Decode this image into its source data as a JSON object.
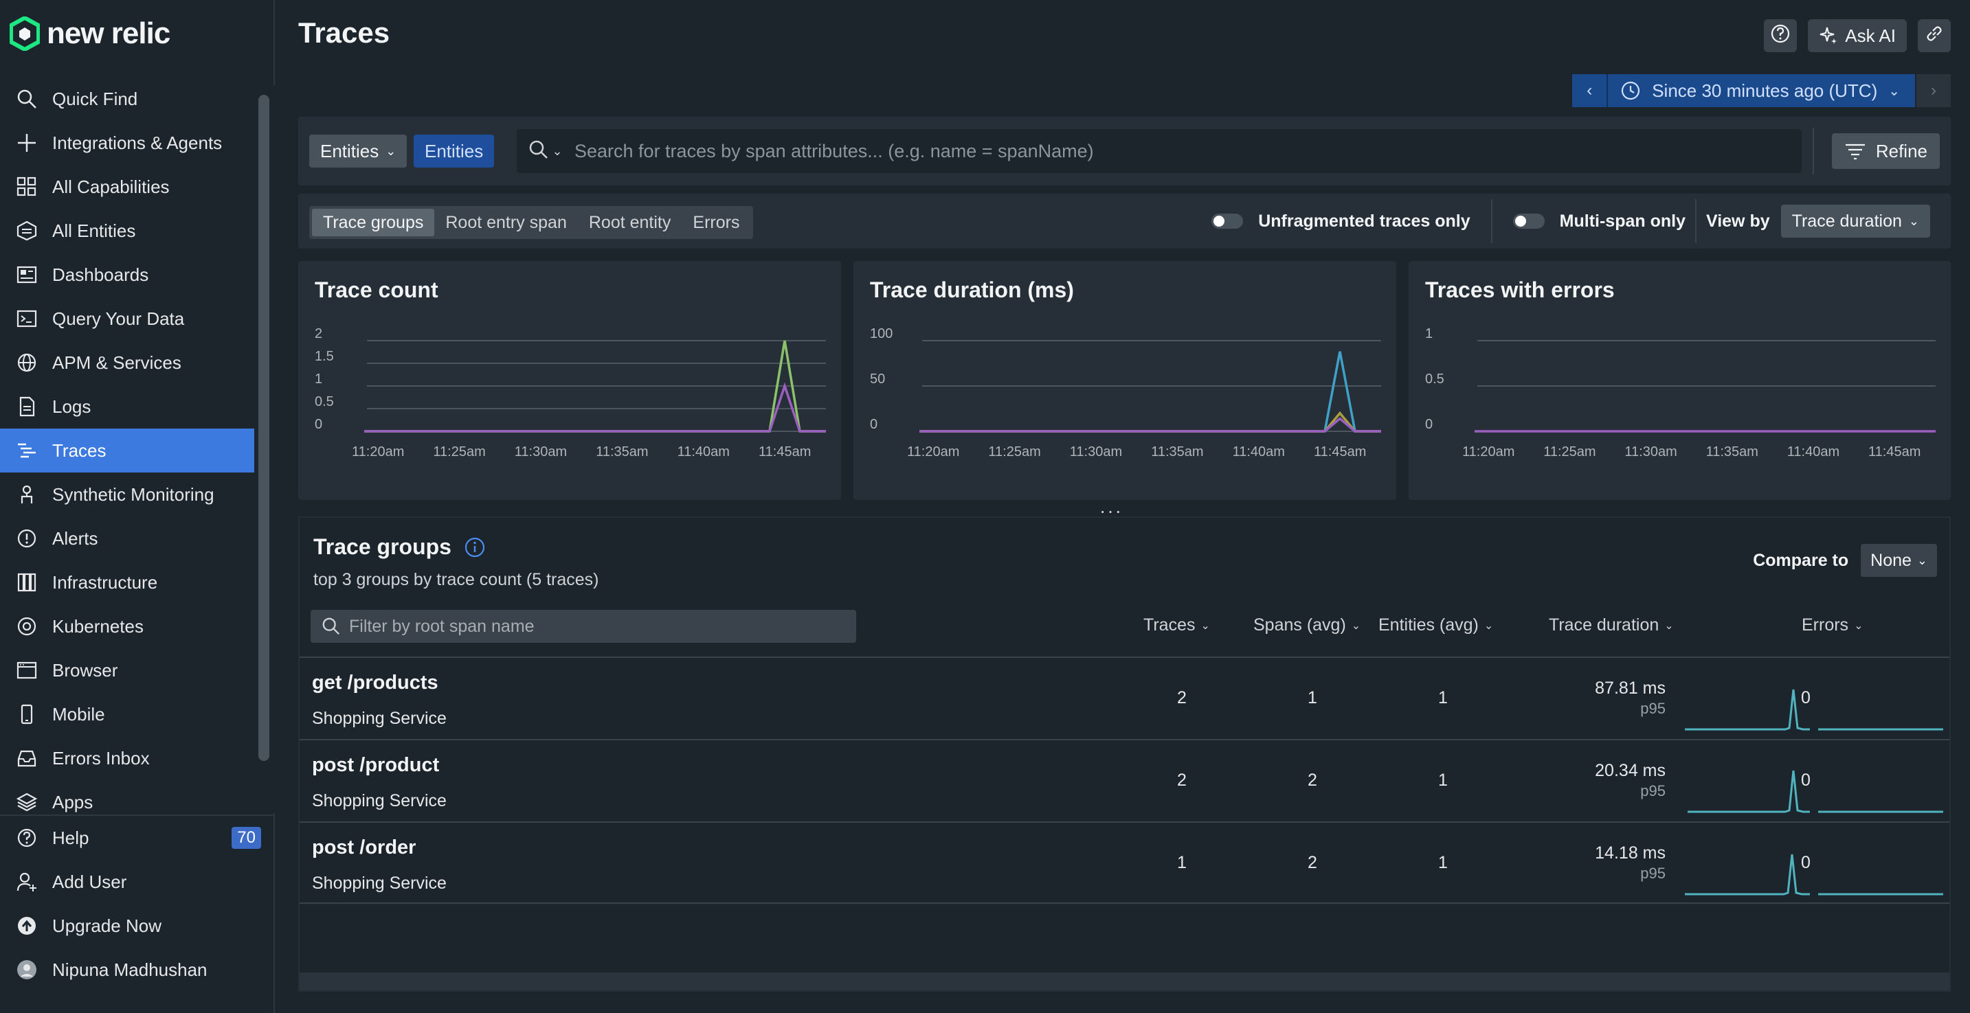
{
  "app": {
    "logo_text": "new relic"
  },
  "sidebar": {
    "items": [
      {
        "label": "Quick Find",
        "icon": "search-icon"
      },
      {
        "label": "Integrations & Agents",
        "icon": "plus-icon"
      },
      {
        "label": "All Capabilities",
        "icon": "grid-icon"
      },
      {
        "label": "All Entities",
        "icon": "entities-icon"
      },
      {
        "label": "Dashboards",
        "icon": "dashboard-icon"
      },
      {
        "label": "Query Your Data",
        "icon": "terminal-icon"
      },
      {
        "label": "APM & Services",
        "icon": "globe-icon"
      },
      {
        "label": "Logs",
        "icon": "document-icon"
      },
      {
        "label": "Traces",
        "icon": "traces-icon",
        "active": true
      },
      {
        "label": "Synthetic Monitoring",
        "icon": "robot-icon"
      },
      {
        "label": "Alerts",
        "icon": "alert-icon"
      },
      {
        "label": "Infrastructure",
        "icon": "columns-icon"
      },
      {
        "label": "Kubernetes",
        "icon": "kubernetes-icon"
      },
      {
        "label": "Browser",
        "icon": "browser-icon"
      },
      {
        "label": "Mobile",
        "icon": "mobile-icon"
      },
      {
        "label": "Errors Inbox",
        "icon": "inbox-icon"
      },
      {
        "label": "Apps",
        "icon": "layers-icon"
      }
    ],
    "bottom": [
      {
        "label": "Help",
        "icon": "help-icon",
        "badge": "70"
      },
      {
        "label": "Add User",
        "icon": "add-user-icon"
      },
      {
        "label": "Upgrade Now",
        "icon": "upgrade-icon"
      },
      {
        "label": "Nipuna Madhushan",
        "icon": "avatar"
      }
    ]
  },
  "header": {
    "title": "Traces",
    "ask_ai": "Ask AI",
    "time_range": "Since 30 minutes ago (UTC)"
  },
  "filter_bar": {
    "entities_dropdown": "Entities",
    "entities_pill": "Entities",
    "search_placeholder": "Search for traces by span attributes... (e.g. name = spanName)",
    "refine": "Refine"
  },
  "tabs": [
    "Trace groups",
    "Root entry span",
    "Root entity",
    "Errors"
  ],
  "toggles": {
    "unfragmented": "Unfragmented traces only",
    "multispan": "Multi-span only",
    "view_by_label": "View by",
    "view_by_value": "Trace duration"
  },
  "chart_data": [
    {
      "type": "line",
      "title": "Trace count",
      "x": [
        "11:20am",
        "11:25am",
        "11:30am",
        "11:35am",
        "11:40am",
        "11:45am"
      ],
      "y_ticks": [
        "2",
        "1.5",
        "1",
        "0.5",
        "0"
      ],
      "ylim": [
        0,
        2
      ],
      "series": [
        {
          "color": "#8dc26a",
          "peak": 2
        },
        {
          "color": "#9b5fc0",
          "peak": 1
        }
      ]
    },
    {
      "type": "line",
      "title": "Trace duration (ms)",
      "x": [
        "11:20am",
        "11:25am",
        "11:30am",
        "11:35am",
        "11:40am",
        "11:45am"
      ],
      "y_ticks": [
        "100",
        "50",
        "0"
      ],
      "ylim": [
        0,
        100
      ],
      "series": [
        {
          "color": "#3fa0c8",
          "peak": 88
        },
        {
          "color": "#a8a040",
          "peak": 20
        },
        {
          "color": "#9b5fc0",
          "peak": 14
        }
      ]
    },
    {
      "type": "line",
      "title": "Traces with errors",
      "x": [
        "11:20am",
        "11:25am",
        "11:30am",
        "11:35am",
        "11:40am",
        "11:45am"
      ],
      "y_ticks": [
        "1",
        "0.5",
        "0"
      ],
      "ylim": [
        0,
        1
      ],
      "series": [
        {
          "color": "#9b5fc0",
          "peak": 0
        }
      ]
    }
  ],
  "trace_groups": {
    "title": "Trace groups",
    "subtitle": "top 3 groups by trace count (5 traces)",
    "compare_label": "Compare to",
    "compare_value": "None",
    "filter_placeholder": "Filter by root span name",
    "columns": [
      "Traces",
      "Spans (avg)",
      "Entities (avg)",
      "Trace duration",
      "Errors"
    ],
    "rows": [
      {
        "name": "get /products",
        "service": "Shopping Service",
        "traces": "2",
        "spans": "1",
        "entities": "1",
        "duration": "87.81 ms",
        "duration_stat": "p95",
        "errors": "0"
      },
      {
        "name": "post /product",
        "service": "Shopping Service",
        "traces": "2",
        "spans": "2",
        "entities": "1",
        "duration": "20.34 ms",
        "duration_stat": "p95",
        "errors": "0"
      },
      {
        "name": "post /order",
        "service": "Shopping Service",
        "traces": "1",
        "spans": "2",
        "entities": "1",
        "duration": "14.18 ms",
        "duration_stat": "p95",
        "errors": "0"
      }
    ]
  },
  "colors": {
    "accent": "#3c7ae0",
    "spark": "#4fb3c0"
  }
}
